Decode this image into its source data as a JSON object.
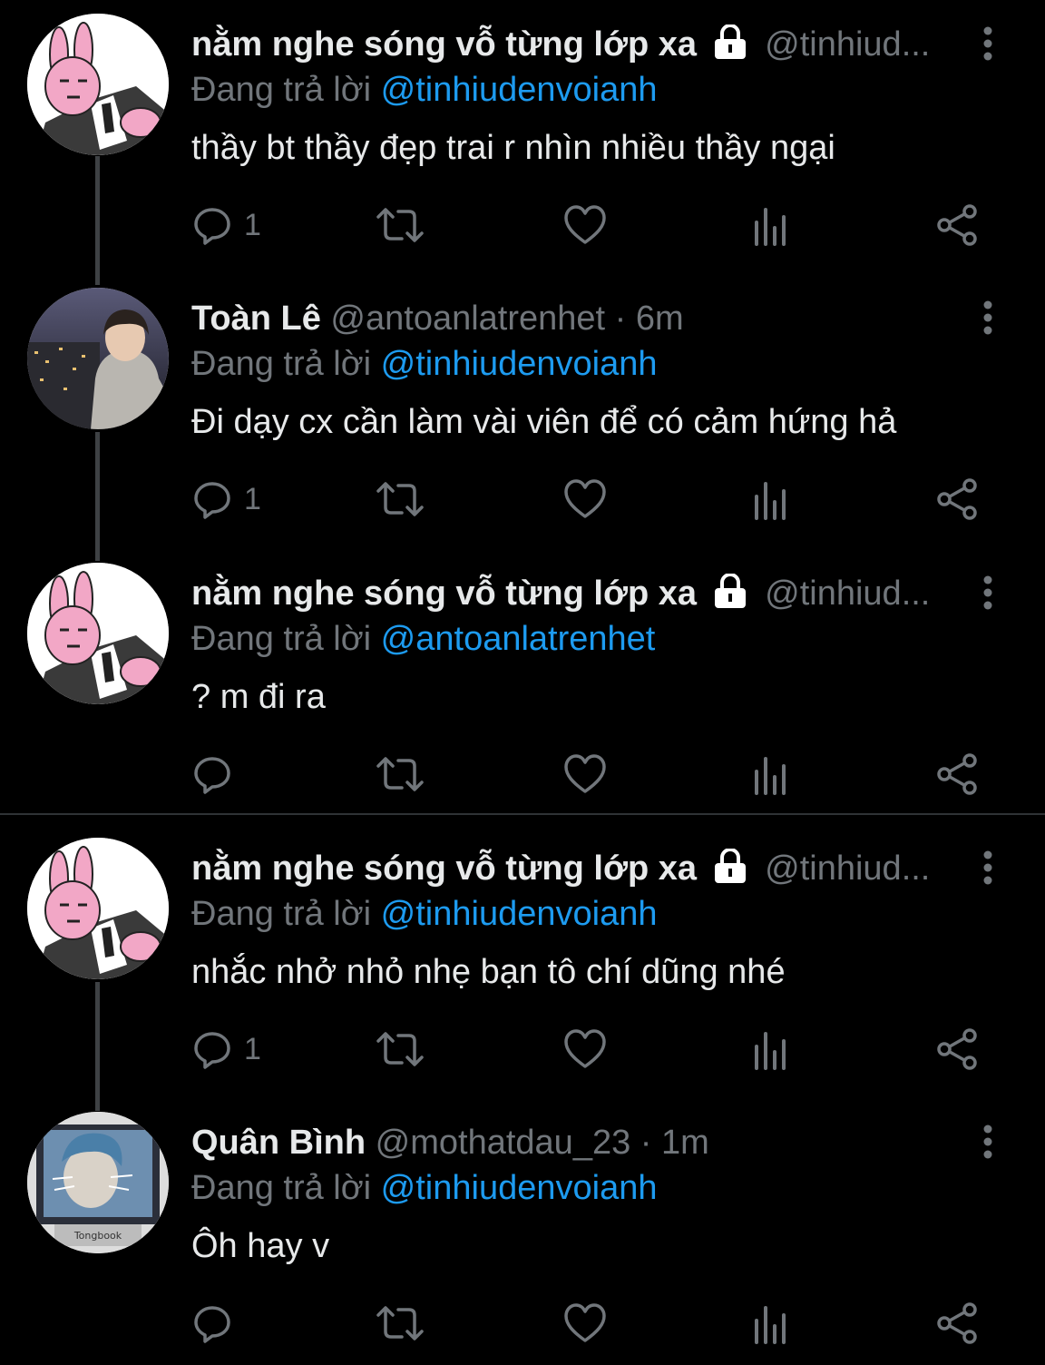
{
  "tweets": [
    {
      "name": "nằm nghe sóng vỗ từng lớp xa",
      "handle": "@tinhiud...",
      "time": "",
      "locked": true,
      "reply_prefix": "Đang trả lời ",
      "reply_to": "@tinhiudenvoianh",
      "text": "thầy bt thầy đẹp trai r nhìn nhiều thầy ngại",
      "reply_count": "1",
      "avatar_icon": "rabbit-suit-avatar"
    },
    {
      "name": "Toàn Lê",
      "handle": "@antoanlatrenhet",
      "time": "· 6m",
      "locked": false,
      "reply_prefix": "Đang trả lời ",
      "reply_to": "@tinhiudenvoianh",
      "text": "Đi dạy cx cần làm vài viên để có cảm hứng hả",
      "reply_count": "1",
      "avatar_icon": "city-night-photo-avatar"
    },
    {
      "name": "nằm nghe sóng vỗ từng lớp xa",
      "handle": "@tinhiud...",
      "time": "",
      "locked": true,
      "reply_prefix": "Đang trả lời ",
      "reply_to": "@antoanlatrenhet",
      "text": "? m đi ra",
      "reply_count": "",
      "avatar_icon": "rabbit-suit-avatar"
    },
    {
      "name": "nằm nghe sóng vỗ từng lớp xa",
      "handle": "@tinhiud...",
      "time": "",
      "locked": true,
      "reply_prefix": "Đang trả lời ",
      "reply_to": "@tinhiudenvoianh",
      "text": "nhắc nhở nhỏ nhẹ bạn tô chí dũng nhé",
      "reply_count": "1",
      "avatar_icon": "rabbit-suit-avatar"
    },
    {
      "name": "Quân Bình",
      "handle": "@mothatdau_23",
      "time": "· 1m",
      "locked": false,
      "reply_prefix": "Đang trả lời ",
      "reply_to": "@tinhiudenvoianh",
      "text": "Ôh hay v",
      "reply_count": "",
      "avatar_icon": "monitor-photo-avatar"
    }
  ],
  "monitor_brand": "Tongbook",
  "colors": {
    "background": "#000000",
    "text": "#e7e9ea",
    "muted": "#71767b",
    "mention": "#1d9bf0",
    "thread_line": "#3e4144"
  }
}
